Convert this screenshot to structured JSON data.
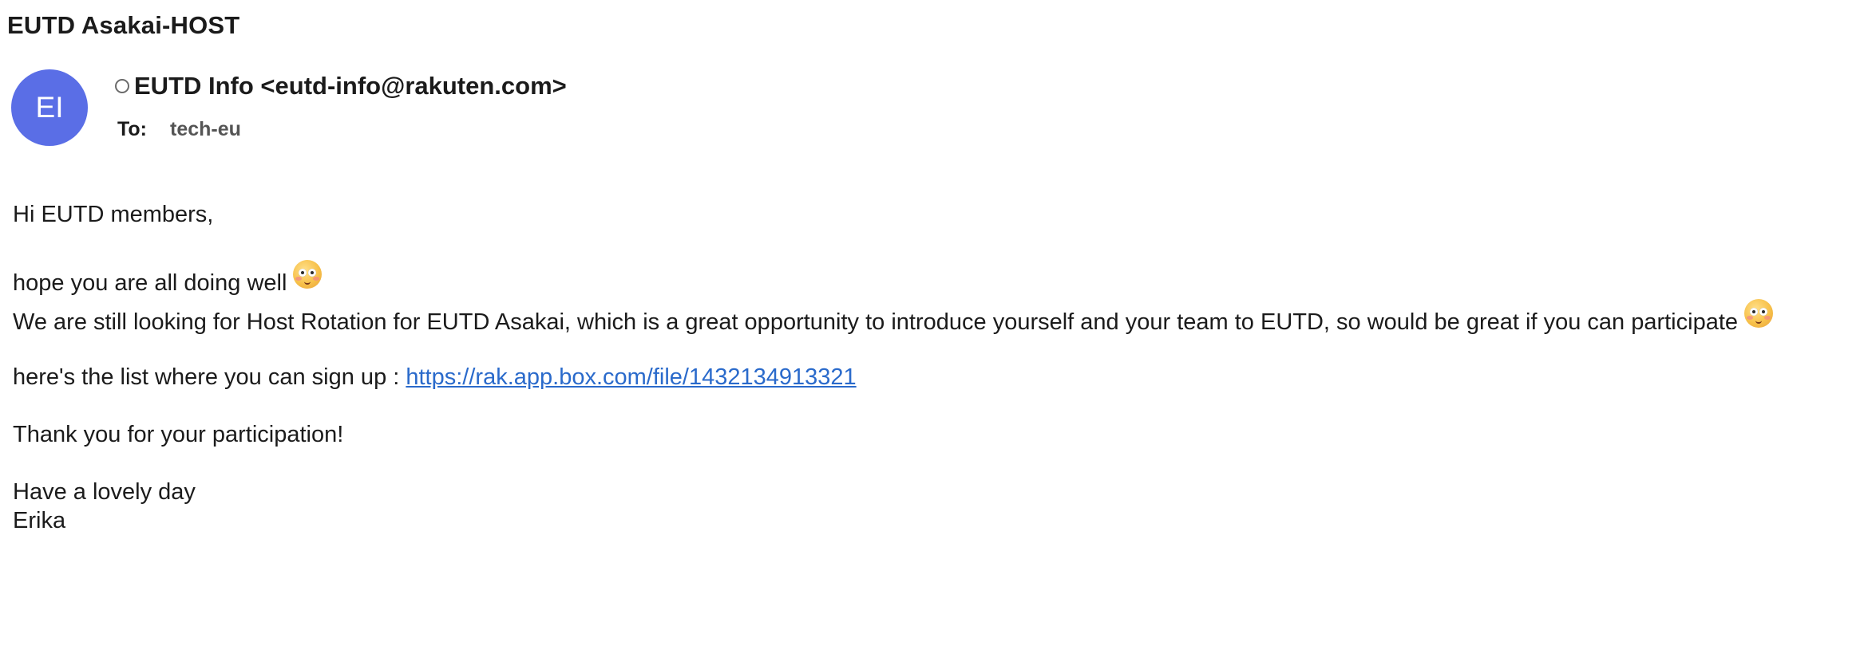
{
  "subject": "EUTD Asakai-HOST",
  "sender": {
    "initials": "EI",
    "display": "EUTD Info <eutd-info@rakuten.com>",
    "avatar_color": "#5a6ee6"
  },
  "recipients": {
    "to_label": "To:",
    "to_value": "tech-eu"
  },
  "body": {
    "greeting": "Hi EUTD members,",
    "line_hope": "hope you are all doing well",
    "line_looking": "We are still looking for Host Rotation for EUTD Asakai, which is a great opportunity to introduce yourself and your team to EUTD, so would be great if you can participate",
    "list_prefix": "here's the list where you can sign up : ",
    "list_link": "https://rak.app.box.com/file/1432134913321",
    "thanks": "Thank you for your participation!",
    "closing": "Have a lovely day",
    "signature": "Erika"
  },
  "icons": {
    "status": "presence-ring-icon",
    "emoji": "smiling-face-icon"
  },
  "colors": {
    "link": "#2a6acb",
    "avatar": "#5a6ee6"
  }
}
